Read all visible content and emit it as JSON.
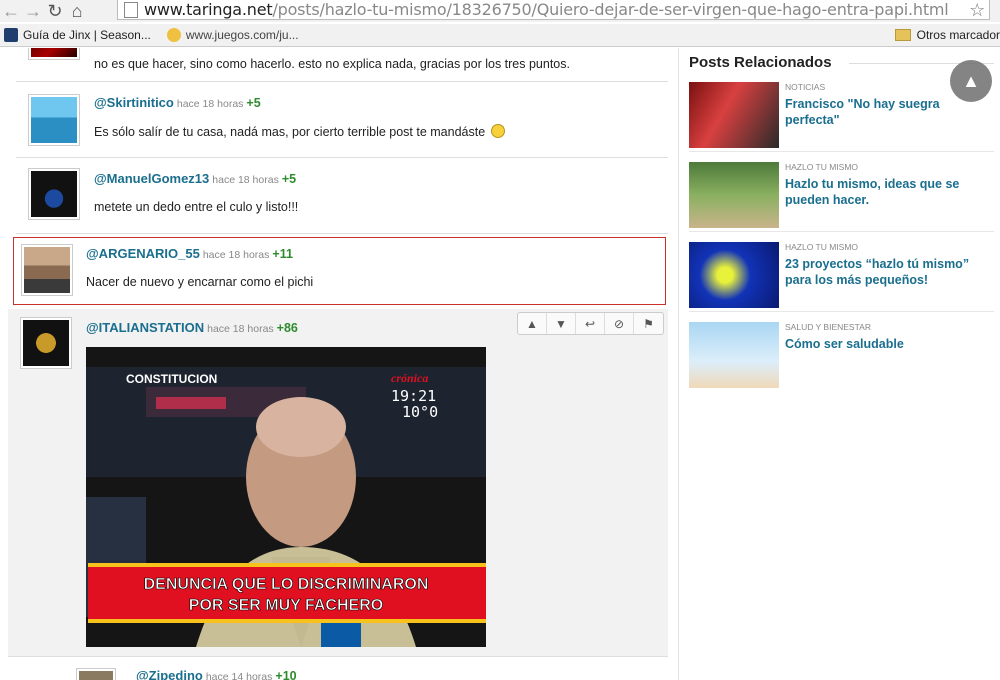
{
  "browser": {
    "url_host": "www.taringa.net",
    "url_path": "/posts/hazlo-tu-mismo/18326750/Quiero-dejar-de-ser-virgen-que-hago-entra-papi.html",
    "bookmarks": [
      {
        "label": "Guía de Jinx | Season..."
      },
      {
        "label": "www.juegos.com/ju..."
      }
    ],
    "other_bookmarks": "Otros marcador"
  },
  "comments": [
    {
      "text": "no es que hacer, sino como hacerlo. esto no explica nada, gracias por los tres puntos."
    },
    {
      "user": "@Skirtinitico",
      "time": "hace 18 horas",
      "score": "+5",
      "text": "Es sólo salír de tu casa, nadá mas, por cierto terrible post te mandáste"
    },
    {
      "user": "@ManuelGomez13",
      "time": "hace 18 horas",
      "score": "+5",
      "text": "metete un dedo entre el culo y listo!!!"
    },
    {
      "user": "@ARGENARIO_55",
      "time": "hace 18 horas",
      "score": "+11",
      "text": "Nacer de nuevo y encarnar como el pichi"
    },
    {
      "user": "@ITALIANSTATION",
      "time": "hace 18 horas",
      "score": "+86"
    },
    {
      "user": "@Zipedino",
      "time": "hace 14 horas",
      "score": "+10"
    }
  ],
  "meme": {
    "station": "CONSTITUCION",
    "channel": "crónica",
    "clock": "19:21",
    "temp": "10°0",
    "caption_line1": "DENUNCIA QUE LO DISCRIMINARON",
    "caption_line2": "POR SER MUY FACHERO"
  },
  "sidebar": {
    "title": "Posts Relacionados",
    "items": [
      {
        "category": "NOTICIAS",
        "title": "Francisco \"No hay suegra perfecta\""
      },
      {
        "category": "HAZLO TU MISMO",
        "title": "Hazlo tu mismo, ideas que se pueden hacer."
      },
      {
        "category": "HAZLO TU MISMO",
        "title": "23 proyectos “hazlo tú mismo” para los más pequeños!"
      },
      {
        "category": "SALUD Y BIENESTAR",
        "title": "Cómo ser saludable"
      }
    ]
  },
  "colors": {
    "username": "#1a6e8e",
    "score": "#2e8b2e",
    "highlight_border": "#c9302c"
  }
}
